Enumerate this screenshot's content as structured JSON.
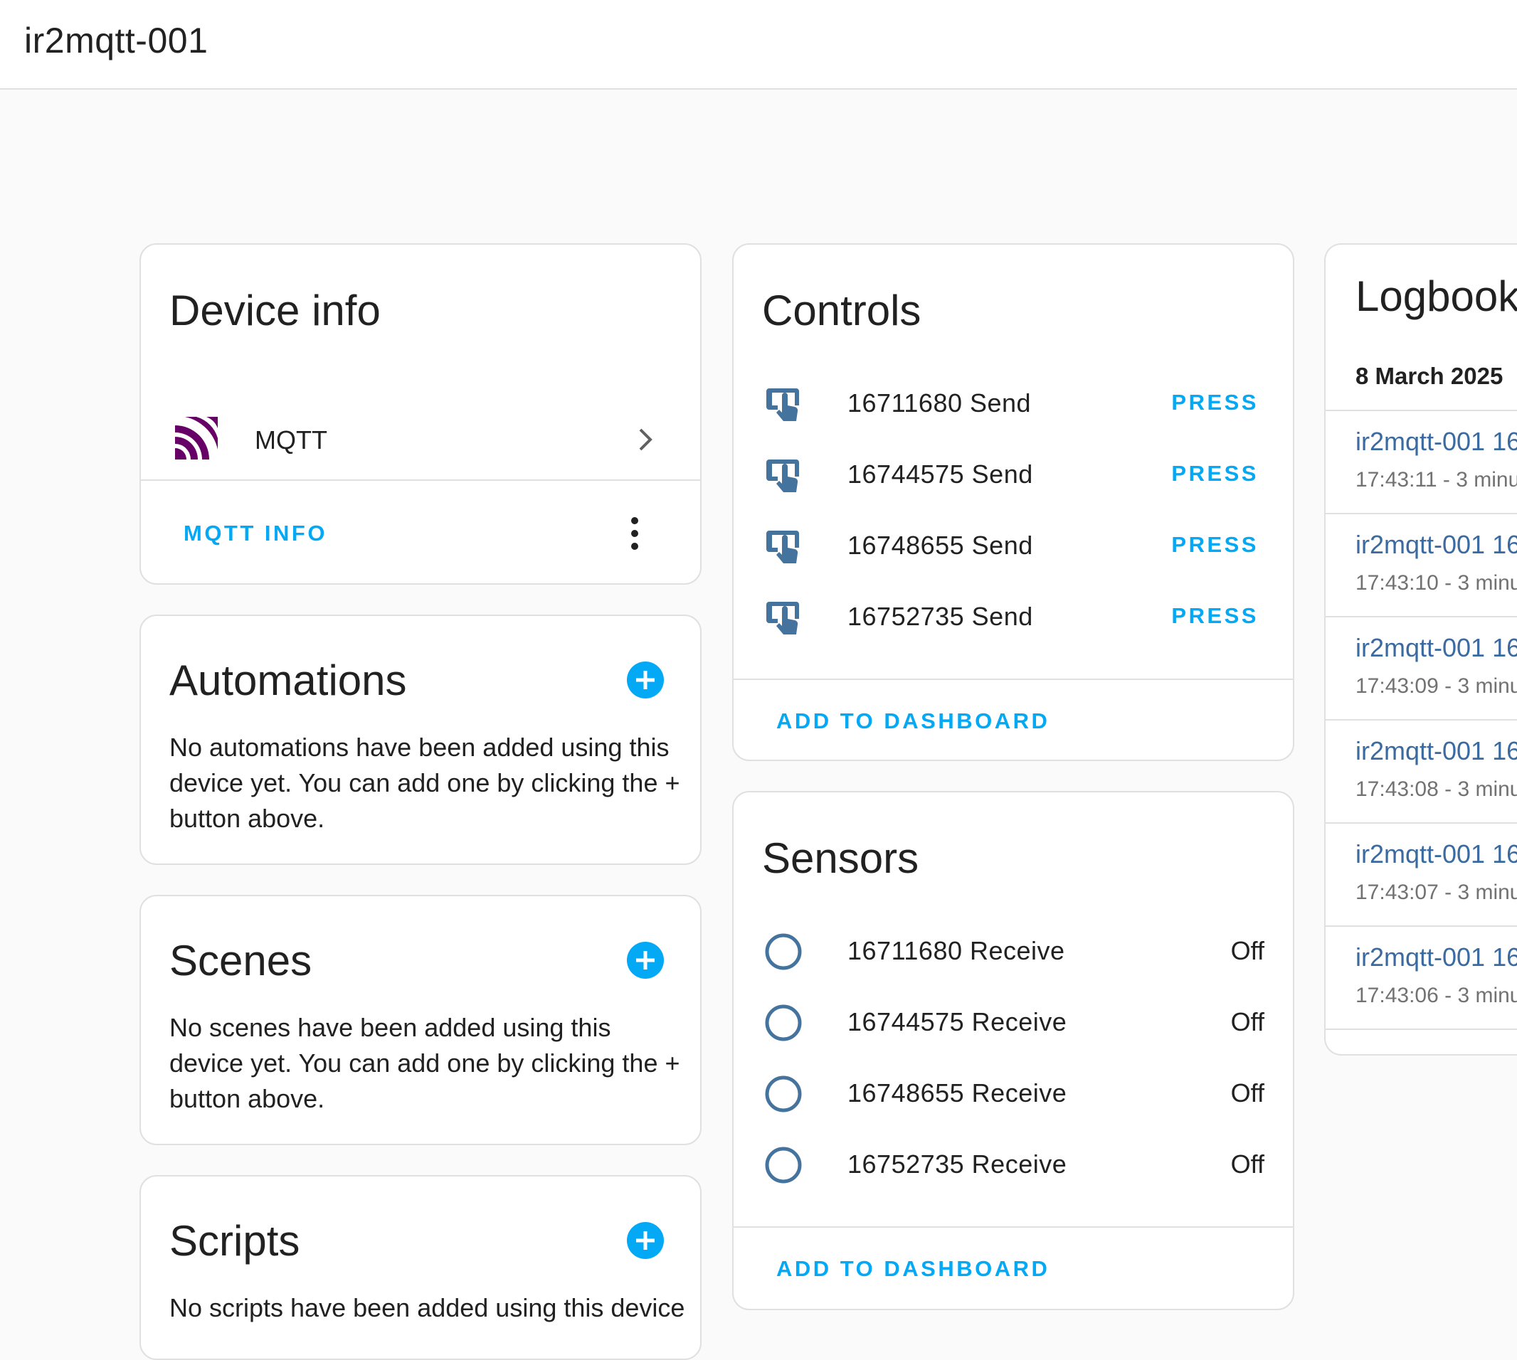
{
  "header": {
    "title": "ir2mqtt-001"
  },
  "device_info": {
    "title": "Device info",
    "integration_name": "MQTT",
    "mqtt_info_label": "MQTT INFO"
  },
  "automations": {
    "title": "Automations",
    "empty_text": "No automations have been added using this device yet. You can add one by clicking the + button above."
  },
  "scenes": {
    "title": "Scenes",
    "empty_text": "No scenes have been added using this device yet. You can add one by clicking the + button above."
  },
  "scripts": {
    "title": "Scripts",
    "empty_text": "No scripts have been added using this device"
  },
  "controls": {
    "title": "Controls",
    "items": [
      {
        "name": "16711680 Send",
        "action": "PRESS"
      },
      {
        "name": "16744575 Send",
        "action": "PRESS"
      },
      {
        "name": "16748655 Send",
        "action": "PRESS"
      },
      {
        "name": "16752735 Send",
        "action": "PRESS"
      }
    ],
    "add_label": "ADD TO DASHBOARD"
  },
  "sensors": {
    "title": "Sensors",
    "items": [
      {
        "name": "16711680 Receive",
        "state": "Off"
      },
      {
        "name": "16744575 Receive",
        "state": "Off"
      },
      {
        "name": "16748655 Receive",
        "state": "Off"
      },
      {
        "name": "16752735 Receive",
        "state": "Off"
      }
    ],
    "add_label": "ADD TO DASHBOARD"
  },
  "logbook": {
    "title": "Logbook",
    "date": "8 March 2025",
    "entries": [
      {
        "name": "ir2mqtt-001 16",
        "time": "17:43:11 - 3 minu"
      },
      {
        "name": "ir2mqtt-001 16",
        "time": "17:43:10 - 3 minu"
      },
      {
        "name": "ir2mqtt-001 16",
        "time": "17:43:09 - 3 minu"
      },
      {
        "name": "ir2mqtt-001 16",
        "time": "17:43:08 - 3 minu"
      },
      {
        "name": "ir2mqtt-001 16",
        "time": "17:43:07 - 3 minu"
      },
      {
        "name": "ir2mqtt-001 16",
        "time": "17:43:06 - 3 minu"
      }
    ]
  },
  "colors": {
    "accent": "#03a9f4",
    "icon_blue": "#44739e",
    "mqtt_purple": "#660066",
    "log_link": "#3a6aa0"
  },
  "icons": [
    "mqtt-logo-icon",
    "chevron-right-icon",
    "more-vert-icon",
    "plus-circle-icon",
    "gesture-tap-button-icon",
    "circle-outline-icon"
  ]
}
